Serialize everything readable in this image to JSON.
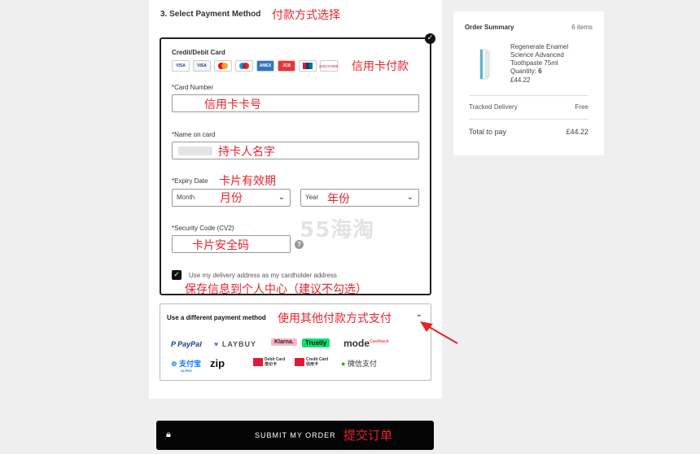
{
  "payment": {
    "section_title": "3. Select Payment Method",
    "section_title_note": "付款方式选择",
    "card_label": "Credit/Debit Card",
    "card_note": "信用卡付款",
    "card_logos": [
      "VISA",
      "VISA",
      "MC",
      "Maestro",
      "AMEX",
      "JCB",
      "UnionPay",
      "DISCOVER"
    ],
    "card_number_label": "*Card Number",
    "card_number_note": "信用卡卡号",
    "name_label": "*Name on card",
    "name_note": "持卡人名字",
    "expiry_label": "*Expiry Date",
    "expiry_note": "卡片有效期",
    "month_value": "Month",
    "month_note": "月份",
    "year_value": "Year",
    "year_note": "年份",
    "cvv_label": "*Security Code (CV2)",
    "cvv_note": "卡片安全码",
    "help_glyph": "?",
    "address_checkbox_label": "Use my delivery address as my cardholder address",
    "address_note": "保存信息到个人中心（建议不勾选）",
    "alt_label": "Use a different payment method",
    "alt_note": "使用其他付款方式支付",
    "alt_methods": {
      "paypal": "P PayPal",
      "laybuy": "LAYBUY",
      "klarna": "Klarna.",
      "trustly": "Trustly",
      "mode": "mode",
      "mode_sup": "Cashback",
      "alipay": "支付宝",
      "alipay_sub": "ALIPAY",
      "zip": "zip",
      "unionpay_debit": "Debit Card",
      "unionpay_debit_cn": "借记卡",
      "unionpay_credit": "Credit Card",
      "unionpay_credit_cn": "信用卡",
      "wechat": "微信支付"
    }
  },
  "submit": {
    "label": "SUBMIT MY ORDER",
    "note": "提交订单"
  },
  "summary": {
    "title": "Order Summary",
    "count": "6 items",
    "product_name": "Regenerate Enamel Science Advanced Toothpaste 75ml",
    "quantity_label": "Quantity:",
    "quantity": "6",
    "price": "£44.22",
    "delivery_label": "Tracked Delivery",
    "delivery_value": "Free",
    "total_label": "Total to pay",
    "total_value": "£44.22"
  },
  "watermark": "55海淘",
  "colors": {
    "annotation": "#e8232a",
    "button": "#050505"
  }
}
